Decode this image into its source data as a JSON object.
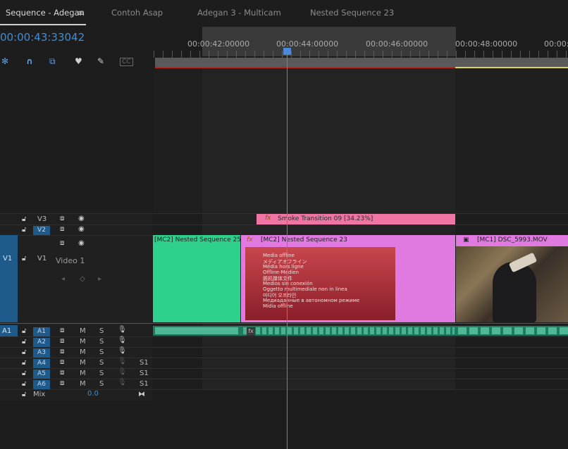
{
  "tabs": [
    {
      "label": "Sequence - Adegan",
      "active": true
    },
    {
      "label": "Contoh Asap",
      "active": false
    },
    {
      "label": "Adegan 3 - Multicam",
      "active": false
    },
    {
      "label": "Nested Sequence 23",
      "active": false
    }
  ],
  "tab_menu_icon": "≡",
  "timecode": "00:00:43:33042",
  "ruler": {
    "labels": [
      "00:00:42:00000",
      "00:00:44:00000",
      "00:00:46:00000",
      "00:00:48:00000",
      "00:00:5"
    ]
  },
  "toolbar": {
    "tools": [
      "snap-icon",
      "magnet-icon",
      "linked-selection-icon",
      "marker-icon",
      "wrench-icon",
      "captions-icon"
    ],
    "captions_label": "CC"
  },
  "tracks": {
    "video": [
      {
        "name": "V3",
        "target": ""
      },
      {
        "name": "V2",
        "target": ""
      },
      {
        "name": "V1",
        "target": "V1",
        "display_name": "Video 1"
      }
    ],
    "audio": [
      {
        "name": "A1",
        "target": "A1",
        "m": "M",
        "s": "S",
        "extra": ""
      },
      {
        "name": "A2",
        "target": "",
        "m": "M",
        "s": "S",
        "extra": ""
      },
      {
        "name": "A3",
        "target": "",
        "m": "M",
        "s": "S",
        "extra": ""
      },
      {
        "name": "A4",
        "target": "",
        "m": "M",
        "s": "S",
        "extra": "S1"
      },
      {
        "name": "A5",
        "target": "",
        "m": "M",
        "s": "S",
        "extra": "S1"
      },
      {
        "name": "A6",
        "target": "",
        "m": "M",
        "s": "S",
        "extra": "S1"
      }
    ],
    "mix_label": "Mix",
    "mix_value": "0.0"
  },
  "clips": {
    "smoke": "Smoke Transition 09 [34.23%]",
    "mc2": "[MC2] Nested Sequence 25",
    "nested": "[MC2] Nested Sequence 23",
    "mc1": "[MC1] DSC_5993.MOV",
    "fx": "fx"
  },
  "offline_text": [
    "Media offline",
    "メディアオフライン",
    "Média hors ligne",
    "Offline-Medien",
    "脱机媒体文件",
    "Medios sin conexión",
    "Oggetto multimediale non in linea",
    "미디어 오프라인",
    "Медиаданные в автономном режиме",
    "Mídia offline"
  ],
  "colors": {
    "accent_blue": "#3c8fd8",
    "clip_green": "#2fcf8c",
    "clip_pink": "#e07ae0",
    "transition_pink": "#f074a4",
    "offline_red": "#c8464c"
  }
}
